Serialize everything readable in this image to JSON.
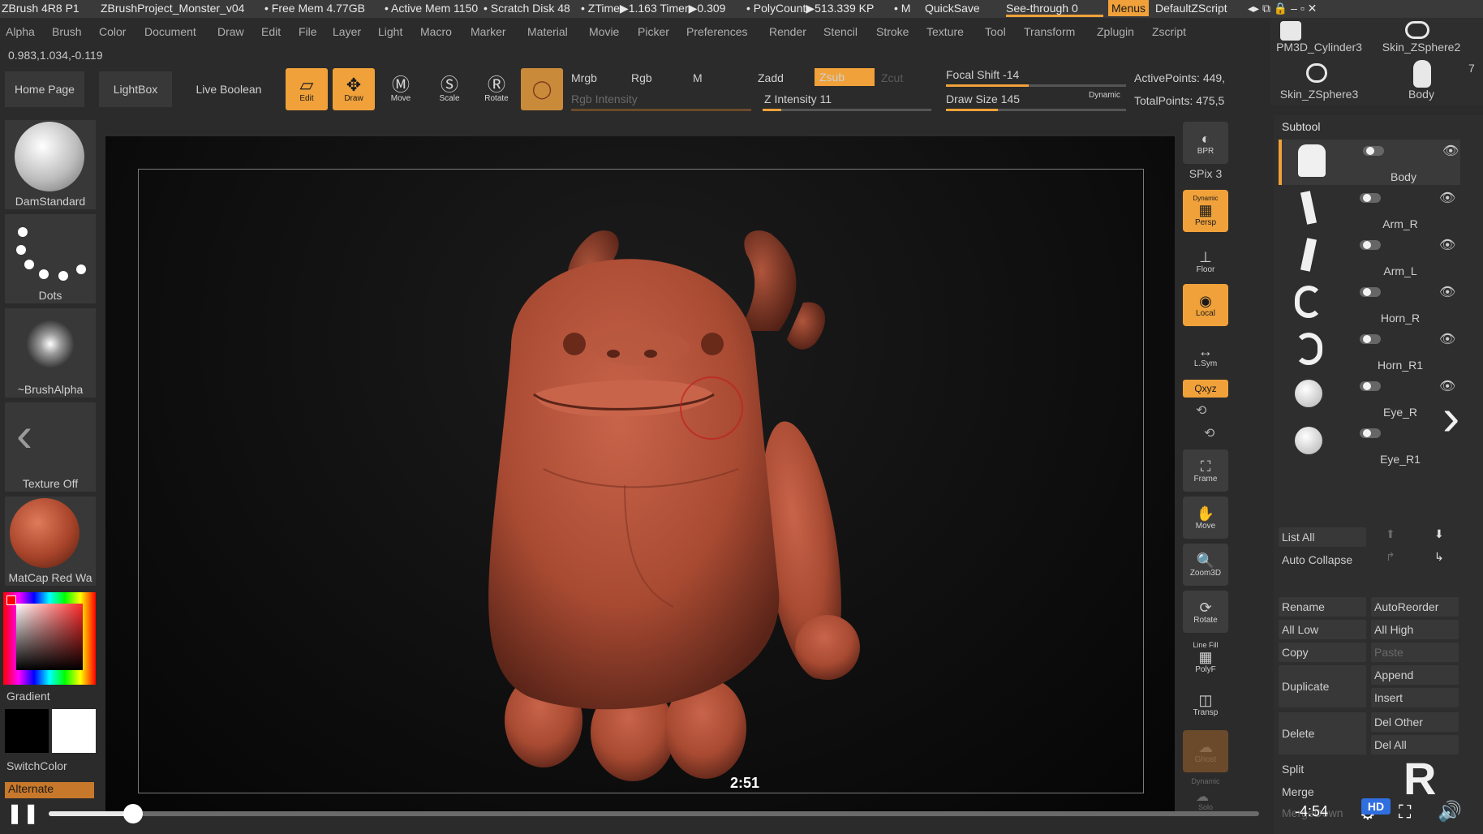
{
  "titlebar": {
    "app": "ZBrush 4R8 P1",
    "project": "ZBrushProject_Monster_v04",
    "free_mem": "• Free Mem 4.77GB",
    "active_mem": "• Active Mem 1150",
    "scratch": "• Scratch Disk 48",
    "ztime": "• ZTime▶1.163 Timer▶0.309",
    "polycount": "• PolyCount▶513.339 KP",
    "m": "• M",
    "quicksave": "QuickSave",
    "see_through": "See-through  0",
    "menus": "Menus",
    "zscript": "DefaultZScript"
  },
  "menubar": [
    "Alpha",
    "Brush",
    "Color",
    "Document",
    "Draw",
    "Edit",
    "File",
    "Layer",
    "Light",
    "Macro",
    "Marker",
    "Material",
    "Movie",
    "Picker",
    "Preferences",
    "Render",
    "Stencil",
    "Stroke",
    "Texture",
    "Tool",
    "Transform",
    "Zplugin",
    "Zscript"
  ],
  "coords": "0.983,1.034,-0.119",
  "top_buttons": {
    "home": "Home Page",
    "lightbox": "LightBox",
    "live_boolean": "Live Boolean"
  },
  "tools": {
    "edit": "Edit",
    "draw": "Draw",
    "move": "Move",
    "scale": "Scale",
    "rotate": "Rotate"
  },
  "paint": {
    "mrgb": "Mrgb",
    "rgb": "Rgb",
    "m": "M",
    "rgb_intensity": "Rgb Intensity"
  },
  "sculpt": {
    "zadd": "Zadd",
    "zsub": "Zsub",
    "zcut": "Zcut",
    "z_intensity": "Z Intensity 11",
    "z_intensity_value": 11
  },
  "focal": {
    "focal_shift": "Focal Shift -14",
    "draw_size": "Draw Size 145",
    "dynamic": "Dynamic"
  },
  "points": {
    "active": "ActivePoints: 449,",
    "total": "TotalPoints: 475,5"
  },
  "top_tool_thumbs": [
    "PM3D_Cylinder3",
    "Skin_ZSphere2",
    "Skin_ZSphere3",
    "Body"
  ],
  "top_tool_count": "7",
  "left": {
    "brush": "DamStandard",
    "stroke": "Dots",
    "alpha": "~BrushAlpha",
    "texture": "Texture Off",
    "material": "MatCap Red Wa",
    "gradient": "Gradient",
    "switch_color": "SwitchColor",
    "alternate": "Alternate"
  },
  "right_toolbar": {
    "bpr": "BPR",
    "spix": "SPix 3",
    "persp": "Persp",
    "dynamic": "Dynamic",
    "floor": "Floor",
    "local": "Local",
    "lsym": "L.Sym",
    "xyz": "Qxyz",
    "frame": "Frame",
    "move": "Move",
    "zoom3d": "Zoom3D",
    "rotate": "Rotate",
    "line_fill": "Line Fill",
    "polyf": "PolyF",
    "transp": "Transp",
    "ghost": "Ghost",
    "solo": "Solo"
  },
  "subtool": {
    "header": "Subtool",
    "items": [
      "Body",
      "Arm_R",
      "Arm_L",
      "Horn_R",
      "Horn_R1",
      "Eye_R",
      "Eye_R1"
    ],
    "list_all": "List All",
    "auto_collapse": "Auto Collapse",
    "buttons": {
      "rename": "Rename",
      "autoreorder": "AutoReorder",
      "all_low": "All Low",
      "all_high": "All High",
      "copy": "Copy",
      "paste": "Paste",
      "duplicate": "Duplicate",
      "append": "Append",
      "insert": "Insert",
      "delete": "Delete",
      "del_other": "Del Other",
      "del_all": "Del All",
      "split": "Split",
      "merge": "Merge",
      "merge_down": "MergeDown"
    }
  },
  "video": {
    "timestamp": "2:51",
    "remaining": "-4:54",
    "hd": "HD",
    "progress": 0.07
  },
  "colors": {
    "accent": "#f0a13a",
    "model": "#b04a32"
  }
}
